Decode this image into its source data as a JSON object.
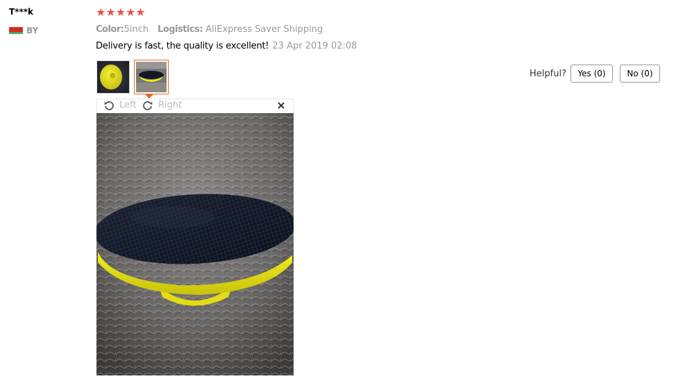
{
  "reviewer": {
    "name": "T***k",
    "country": "BY",
    "flag_colors": {
      "top": "#d52b1e",
      "bottom": "#4aa657"
    }
  },
  "rating": {
    "stars_filled": 5,
    "stars_total": 5,
    "star_glyph": "★",
    "star_color": "#e8534d"
  },
  "order": {
    "color_key": "Color:",
    "color_value": "5inch",
    "logistics_key": "Logistics:",
    "logistics_value": "AliExpress Saver Shipping"
  },
  "review": {
    "text": "Delivery is fast, the quality is excellent!",
    "date": "23 Apr 2019 02:08"
  },
  "photos": {
    "thumbnails": [
      {
        "name": "yellow-pad-thumbnail",
        "selected": false
      },
      {
        "name": "black-pad-thumbnail",
        "selected": true
      }
    ],
    "viewer": {
      "rotate_left_label": "Left",
      "rotate_right_label": "Right",
      "close_glyph": "×"
    }
  },
  "feedback": {
    "helpful_label": "Helpful?",
    "yes_label": "Yes (0)",
    "no_label": "No (0)"
  },
  "colors": {
    "accent_orange": "#e56a1e",
    "muted_text": "#999999"
  }
}
